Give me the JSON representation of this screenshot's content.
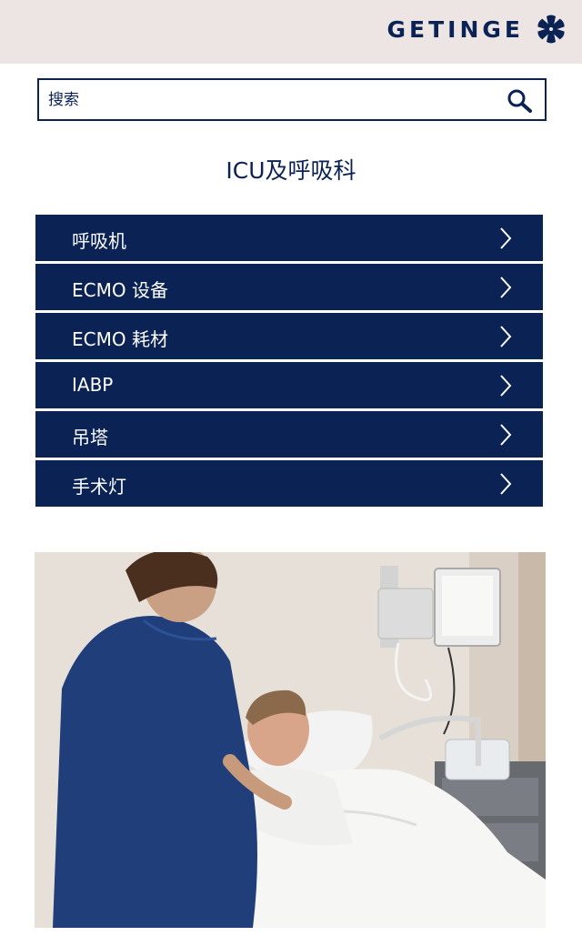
{
  "header": {
    "brand": "GETINGE",
    "logo_icon": "getinge-star-icon"
  },
  "search": {
    "placeholder": "搜索",
    "value": "",
    "icon": "search-icon"
  },
  "page_title": "ICU及呼吸科",
  "menu": {
    "items": [
      {
        "label": "呼吸机"
      },
      {
        "label": "ECMO 设备"
      },
      {
        "label": "ECMO 耗材"
      },
      {
        "label": "IABP"
      },
      {
        "label": "吊塔"
      },
      {
        "label": "手术灯"
      }
    ]
  },
  "colors": {
    "navy": "#0b2255",
    "header_bg": "#ede5e4",
    "white": "#ffffff"
  }
}
